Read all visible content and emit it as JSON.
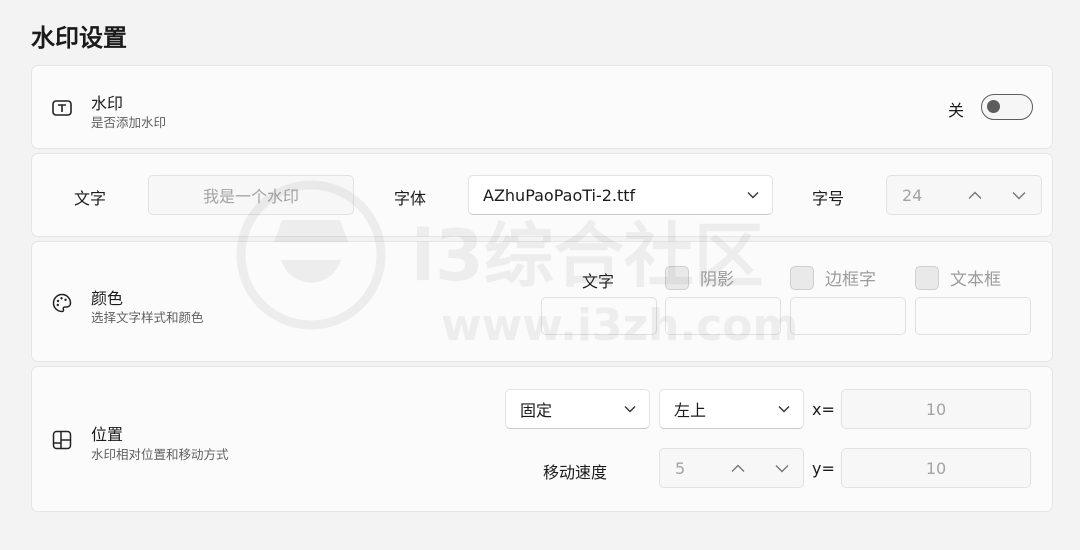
{
  "page": {
    "title": "水印设置"
  },
  "watermark_row": {
    "title": "水印",
    "desc": "是否添加水印",
    "toggle_label": "关",
    "toggle_on": false
  },
  "text_row": {
    "text_label": "文字",
    "text_placeholder": "我是一个水印",
    "font_label": "字体",
    "font_value": "AZhuPaoPaoTi-2.ttf",
    "size_label": "字号",
    "size_value": "24"
  },
  "color_row": {
    "title": "颜色",
    "desc": "选择文字样式和颜色",
    "text_label": "文字",
    "checkboxes": [
      {
        "label": "阴影",
        "checked": false
      },
      {
        "label": "边框字",
        "checked": false
      },
      {
        "label": "文本框",
        "checked": false
      }
    ]
  },
  "position_row": {
    "title": "位置",
    "desc": "水印相对位置和移动方式",
    "mode_value": "固定",
    "anchor_value": "左上",
    "x_label": "x=",
    "x_value": "10",
    "speed_label": "移动速度",
    "speed_value": "5",
    "y_label": "y=",
    "y_value": "10"
  },
  "overlay_watermark": {
    "brand": "i3综合社区",
    "url": "www.i3zh.com"
  },
  "colors": {
    "background": "#f3f3f3",
    "card": "#fbfbfb",
    "border": "#e5e5e5",
    "toggle": "#5d5d5d",
    "disabled_text": "#a3a3a3"
  }
}
